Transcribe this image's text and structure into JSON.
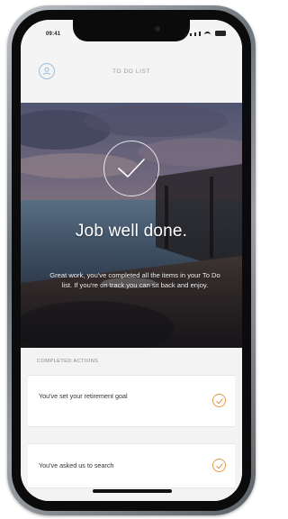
{
  "status_bar": {
    "time": "09:41"
  },
  "header": {
    "title": "TO DO LIST",
    "menu_icon": "profile-icon"
  },
  "hero": {
    "check_icon": "check-circle-icon",
    "title": "Job well done.",
    "body": "Great work, you've completed all the items in your To Do list. If you're on track you can sit back and enjoy."
  },
  "completed": {
    "header": "COMPLETED ACTIONS",
    "items": [
      {
        "label": "You've set your retirement goal",
        "icon": "check-icon"
      },
      {
        "label": "You've asked us to search",
        "icon": "check-icon"
      }
    ]
  },
  "colors": {
    "accent_orange": "#e8964a",
    "header_icon_blue": "#9fbfd9",
    "background": "#f3f3f3"
  }
}
